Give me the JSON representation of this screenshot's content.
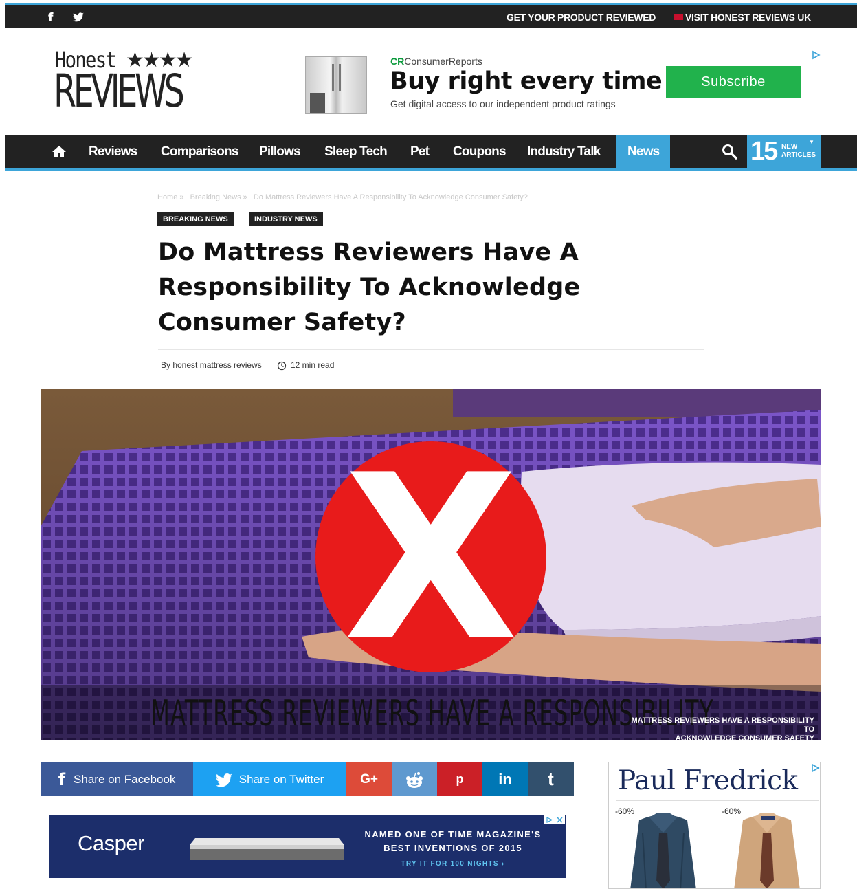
{
  "topbar": {
    "facebook_icon": "f",
    "twitter_icon": "🐦",
    "get_reviewed": "GET YOUR PRODUCT REVIEWED",
    "visit_uk": "VISIT HONEST REVIEWS UK"
  },
  "logo": {
    "honest": "Honest",
    "stars": "★★★★",
    "reviews": "REVIEWS"
  },
  "header_ad": {
    "cr_brand": "CR",
    "cr_name": "ConsumerReports",
    "headline": "Buy right every time",
    "subline": "Get digital access to our independent product ratings",
    "button": "Subscribe"
  },
  "nav": {
    "items": [
      "Reviews",
      "Comparisons",
      "Pillows",
      "Sleep Tech",
      "Pet",
      "Coupons",
      "Industry Talk",
      "News"
    ],
    "count": "15",
    "count_label_1": "NEW",
    "count_label_2": "ARTICLES"
  },
  "breadcrumb": [
    "Home",
    "»",
    "Breaking News",
    "»",
    "Do Mattress Reviewers Have A Responsibility To Acknowledge Consumer Safety?"
  ],
  "badges": [
    "BREAKING NEWS",
    "INDUSTRY NEWS"
  ],
  "article": {
    "title": "Do Mattress Reviewers Have A Responsibility To Acknowledge Consumer Safety?",
    "author": "By honest mattress reviews",
    "read_time": "12 min read"
  },
  "hero": {
    "caption": "MATTRESS REVIEWERS HAVE A RESPONSIBILITY",
    "overlay_1": "MATTRESS REVIEWERS HAVE A RESPONSIBILITY TO",
    "overlay_2": "ACKNOWLEDGE CONSUMER SAFETY",
    "x_mark": "X"
  },
  "share": {
    "facebook": "Share on Facebook",
    "twitter": "Share on Twitter",
    "gplus": "G+",
    "pinterest": "p",
    "linkedin": "in",
    "tumblr": "t"
  },
  "casper_ad": {
    "brand": "Casper",
    "line1": "NAMED ONE OF TIME MAGAZINE'S",
    "line2": "BEST INVENTIONS OF 2015",
    "line3": "TRY IT FOR 100 NIGHTS ›"
  },
  "side_ad": {
    "brand": "Paul Fredrick",
    "discount_1": "-60%",
    "discount_2": "-60%"
  },
  "colors": {
    "accent": "#3da5d9",
    "dark": "#222222",
    "subscribe": "#21b24c",
    "facebook": "#3b5998",
    "twitter": "#1da1f2",
    "gplus": "#dd4b39",
    "reddit": "#5f99cf",
    "pinterest": "#cb2027",
    "linkedin": "#0077b5",
    "tumblr": "#32506d"
  }
}
